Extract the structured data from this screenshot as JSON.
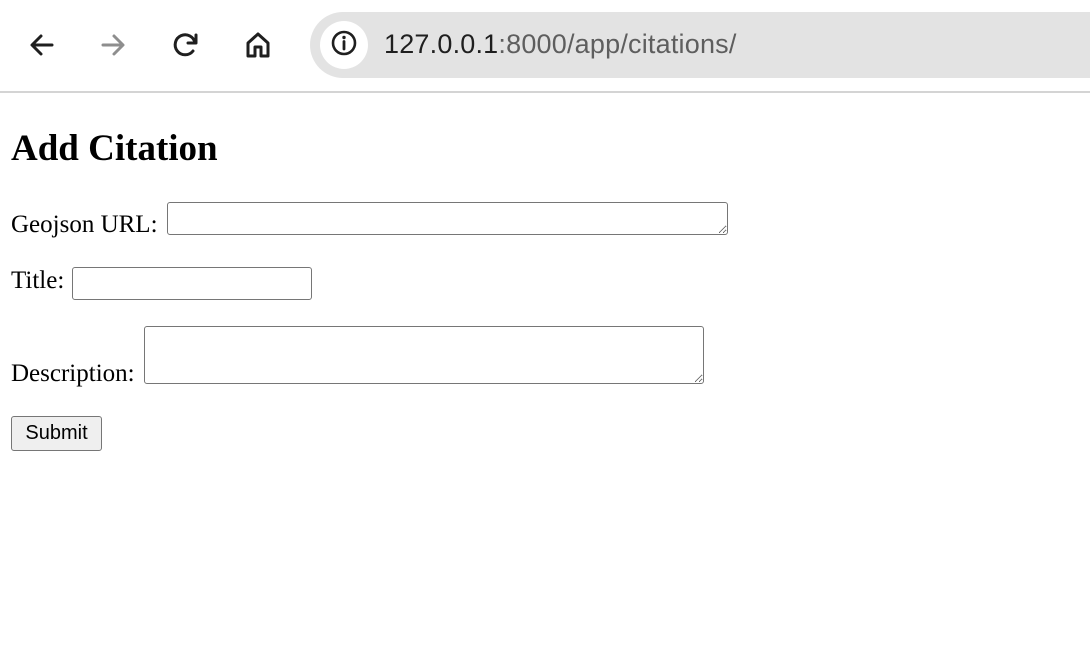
{
  "browser": {
    "url_host": "127.0.0.1",
    "url_path": ":8000/app/citations/",
    "icons": {
      "back": "arrow-left-icon",
      "forward": "arrow-right-icon",
      "reload": "reload-icon",
      "home": "home-icon",
      "site_info": "info-icon"
    }
  },
  "page": {
    "heading": "Add Citation",
    "form": {
      "geojson_url_label": "Geojson URL:",
      "geojson_url_value": "",
      "title_label": "Title:",
      "title_value": "",
      "description_label": "Description:",
      "description_value": "",
      "submit_label": "Submit"
    }
  }
}
